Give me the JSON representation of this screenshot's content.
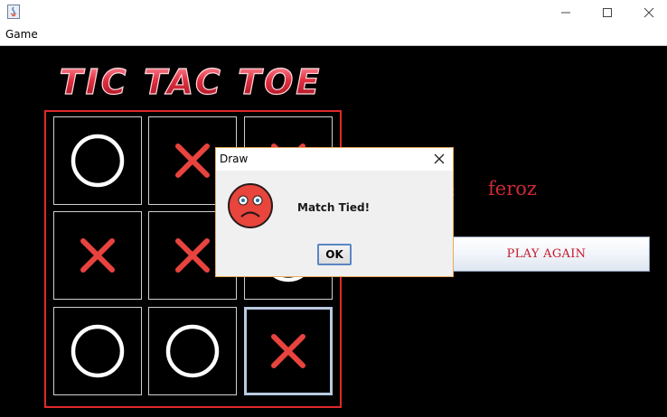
{
  "window": {
    "title": "",
    "minimize_icon": "minimize-icon",
    "maximize_icon": "maximize-icon",
    "close_icon": "close-icon"
  },
  "menu": {
    "items": [
      {
        "label": "Game"
      }
    ]
  },
  "game": {
    "logo_text": "TIC TAC TOE",
    "board": [
      [
        "O",
        "X",
        "X"
      ],
      [
        "X",
        "X",
        "O"
      ],
      [
        "O",
        "O",
        "X"
      ]
    ],
    "selected_cell": "row3-col3",
    "player_label": ":",
    "player_name": "feroz",
    "play_again_label": "PLAY AGAIN"
  },
  "dialog": {
    "title": "Draw",
    "message": "Match Tied!",
    "ok_label": "OK",
    "icon": "sad-face-icon"
  },
  "colors": {
    "accent_red": "#e0282a",
    "x_mark": "#e8433e",
    "o_mark": "#ffffff",
    "background": "#000000"
  }
}
